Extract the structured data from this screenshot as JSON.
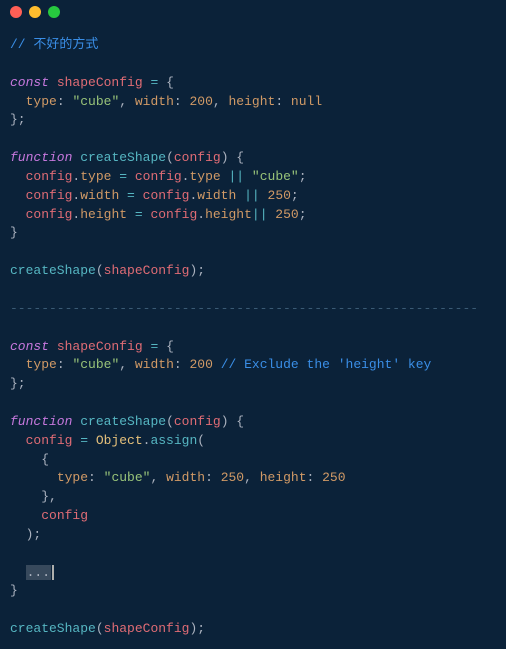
{
  "titlebar": {
    "dots": [
      "red",
      "yellow",
      "green"
    ]
  },
  "code": {
    "c1": "// 不好的方式",
    "l3": {
      "const": "const",
      "name": "shapeConfig",
      "eq": " = ",
      "brace": "{"
    },
    "l4": {
      "indent": "  ",
      "k1": "type",
      "col": ": ",
      "v1": "\"cube\"",
      "com1": ", ",
      "k2": "width",
      "v2": "200",
      "com2": ", ",
      "k3": "height",
      "v3": "null"
    },
    "l5": "};",
    "l7": {
      "fn": "function",
      "name": "createShape",
      "paren1": "(",
      "arg": "config",
      "paren2": ") ",
      "brace": "{"
    },
    "l8": {
      "indent": "  ",
      "cfg": "config",
      "dot": ".",
      "prop": "type",
      "eq": " = ",
      "cfg2": "config",
      "dot2": ".",
      "prop2": "type",
      "or": " || ",
      "val": "\"cube\"",
      "semi": ";"
    },
    "l9": {
      "indent": "  ",
      "cfg": "config",
      "dot": ".",
      "prop": "width",
      "eq": " = ",
      "cfg2": "config",
      "dot2": ".",
      "prop2": "width",
      "or": " || ",
      "val": "250",
      "semi": ";"
    },
    "l10": {
      "indent": "  ",
      "cfg": "config",
      "dot": ".",
      "prop": "height",
      "eq": " = ",
      "cfg2": "config",
      "dot2": ".",
      "prop2": "height",
      "or": "|| ",
      "val": "250",
      "semi": ";"
    },
    "l11": "}",
    "l13": {
      "name": "createShape",
      "paren1": "(",
      "arg": "shapeConfig",
      "paren2": ");"
    },
    "sep": "------------------------------------------------------------",
    "l15": {
      "const": "const",
      "name": "shapeConfig",
      "eq": " = ",
      "brace": "{"
    },
    "l16": {
      "indent": "  ",
      "k1": "type",
      "col": ": ",
      "v1": "\"cube\"",
      "com1": ", ",
      "k2": "width",
      "v2": "200",
      "sp": " ",
      "cm": "// Exclude the 'height' key"
    },
    "l17": "};",
    "l19": {
      "fn": "function",
      "name": "createShape",
      "paren1": "(",
      "arg": "config",
      "paren2": ") ",
      "brace": "{"
    },
    "l20": {
      "indent": "  ",
      "cfg": "config",
      "eq": " = ",
      "obj": "Object",
      "dot": ".",
      "method": "assign",
      "paren": "("
    },
    "l21": "    {",
    "l22": {
      "indent": "      ",
      "k1": "type",
      "col": ": ",
      "v1": "\"cube\"",
      "com1": ", ",
      "k2": "width",
      "v2": "250",
      "com2": ", ",
      "k3": "height",
      "v3": "250"
    },
    "l23": "    },",
    "l24": {
      "indent": "    ",
      "cfg": "config"
    },
    "l25": "  );",
    "l27": {
      "indent": "  ",
      "dots": "..."
    },
    "l28": "}",
    "l30": {
      "name": "createShape",
      "paren1": "(",
      "arg": "shapeConfig",
      "paren2": ");"
    }
  }
}
